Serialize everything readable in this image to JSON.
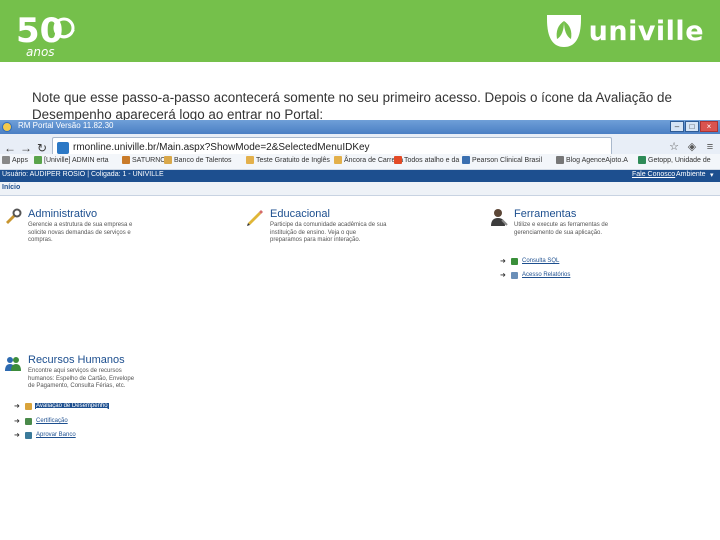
{
  "slide": {
    "logo_50_number": "50",
    "logo_50_sub": "anos",
    "brand_name": "univille",
    "header_color": "#75c04b",
    "note": "Note que esse passo-a-passo acontecerá somente no seu primeiro acesso. Depois o ícone da Avaliação de Desempenho aparecerá logo ao entrar no Portal:"
  },
  "browser": {
    "window_title": "RM Portal Versão 11.82.30",
    "url": "rmonline.univille.br/Main.aspx?ShowMode=2&SelectedMenuIDKey",
    "bookmarks": [
      {
        "label": "Apps",
        "icon": "apps-grid-icon",
        "color": "#888888"
      },
      {
        "label": "[Univille] ADMIN erta",
        "icon": "shield-icon",
        "color": "#5aa44b"
      },
      {
        "label": "SATURNO",
        "icon": "doc-icon",
        "color": "#c97b2a"
      },
      {
        "label": "Banco de Talentos",
        "icon": "doc-icon",
        "color": "#d9a84a"
      },
      {
        "label": "Teste Gratuito de Inglês",
        "icon": "doc-icon",
        "color": "#e3b04b"
      },
      {
        "label": "Âncora de Carreira",
        "icon": "doc-icon",
        "color": "#e3b04b"
      },
      {
        "label": "Todos atalho e da",
        "icon": "office-icon",
        "color": "#e34a26"
      },
      {
        "label": "Pearson Clinical Brasil",
        "icon": "doc-icon",
        "color": "#3a6fb0"
      },
      {
        "label": "Blog AgenceAjoto.A",
        "icon": "doc-icon",
        "color": "#777777"
      },
      {
        "label": "Getopp, Unidade de",
        "icon": "doc-icon",
        "color": "#2e8b57"
      }
    ],
    "app_user": "Usuário: AUDIPER ROSIO  |  Coligada: 1 - UNIVILLE",
    "app_contact": "Fale Conosco",
    "app_env": "Ambiente",
    "breadcrumb": "Início"
  },
  "modules": [
    {
      "title": "Administrativo",
      "icon": "tools-icon",
      "description": "Gerencie a estrutura de sua empresa e solicite novas demandas de serviços e compras."
    },
    {
      "title": "Educacional",
      "icon": "pencil-icon",
      "description": "Participe da comunidade acadêmica de sua instituição de ensino. Veja o que preparamos para maior interação."
    },
    {
      "title": "Ferramentas",
      "icon": "user-tools-icon",
      "description": "Utilize e execute as ferramentas de gerenciamento de sua aplicação.",
      "links": [
        "Consulta SQL",
        "Acesso Relatórios"
      ]
    },
    {
      "title": "Recursos Humanos",
      "icon": "people-icon",
      "description": "Encontre aqui serviços de recursos humanos: Espelho de Cartão, Envelope de Pagamento, Consulta Férias, etc.",
      "links": [
        "Avaliação de Desempenho",
        "Certificação",
        "Aprovar Banco"
      ]
    }
  ]
}
